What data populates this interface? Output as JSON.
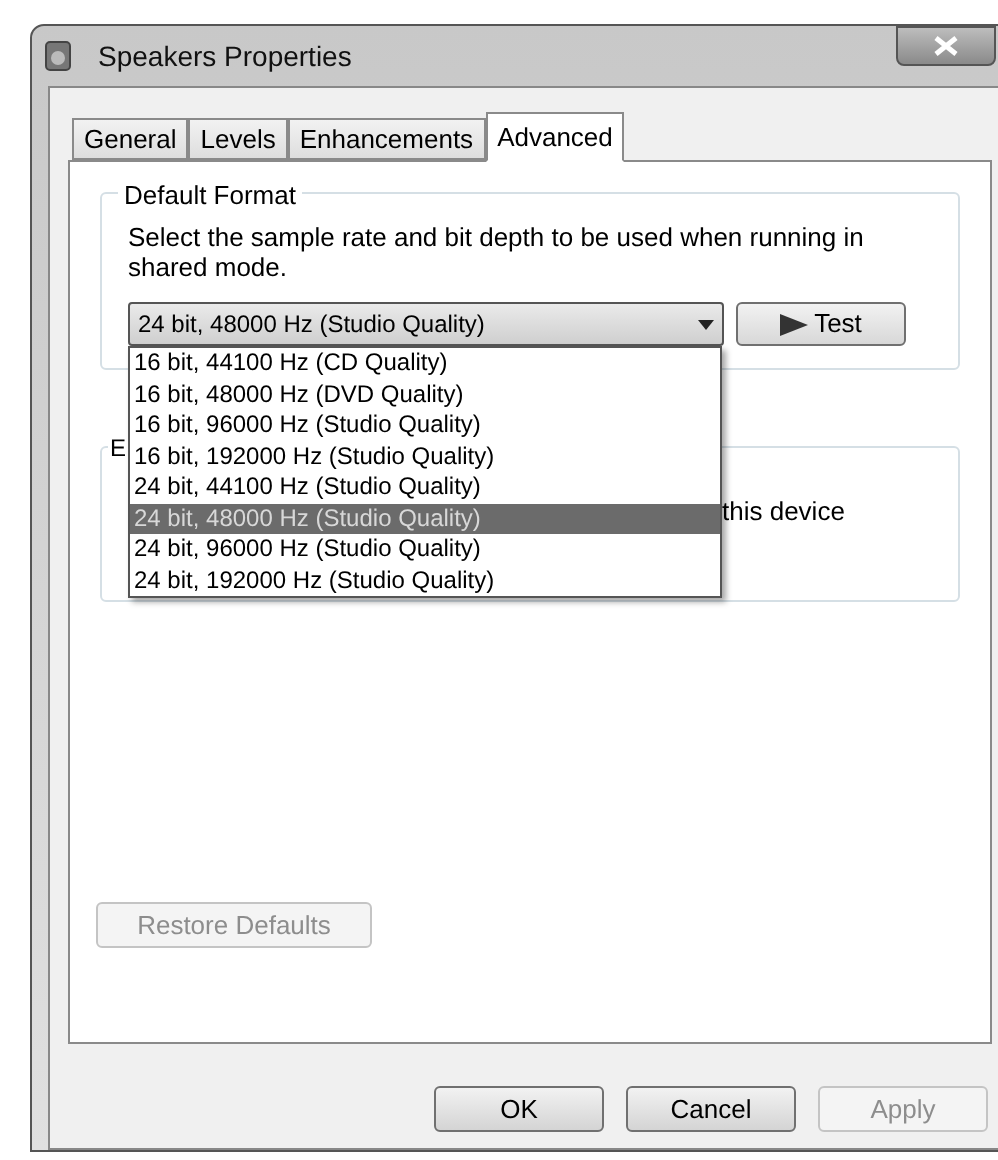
{
  "window": {
    "title": "Speakers Properties"
  },
  "tabs": [
    {
      "label": "General",
      "selected": false
    },
    {
      "label": "Levels",
      "selected": false
    },
    {
      "label": "Enhancements",
      "selected": false
    },
    {
      "label": "Advanced",
      "selected": true
    }
  ],
  "default_format": {
    "title": "Default Format",
    "description": "Select the sample rate and bit depth to be used when running in shared mode.",
    "dropdown": {
      "value": "24 bit, 48000 Hz (Studio Quality)",
      "expanded": true,
      "options": [
        {
          "label": "16 bit, 44100 Hz (CD Quality)",
          "selected": false
        },
        {
          "label": "16 bit, 48000 Hz (DVD Quality)",
          "selected": false
        },
        {
          "label": "16 bit, 96000 Hz (Studio Quality)",
          "selected": false
        },
        {
          "label": "16 bit, 192000 Hz (Studio Quality)",
          "selected": false
        },
        {
          "label": "24 bit, 44100 Hz (Studio Quality)",
          "selected": false
        },
        {
          "label": "24 bit, 48000 Hz (Studio Quality)",
          "selected": true
        },
        {
          "label": "24 bit, 96000 Hz (Studio Quality)",
          "selected": false
        },
        {
          "label": "24 bit, 192000 Hz (Studio Quality)",
          "selected": false
        }
      ]
    },
    "test_button": "Test"
  },
  "group_2": {
    "title": "E",
    "text": "this device"
  },
  "restore_button": {
    "label": "Restore Defaults",
    "disabled": true
  },
  "buttons": [
    {
      "label": "OK",
      "disabled": false
    },
    {
      "label": "Cancel",
      "disabled": false
    },
    {
      "label": "Apply",
      "disabled": true
    }
  ]
}
